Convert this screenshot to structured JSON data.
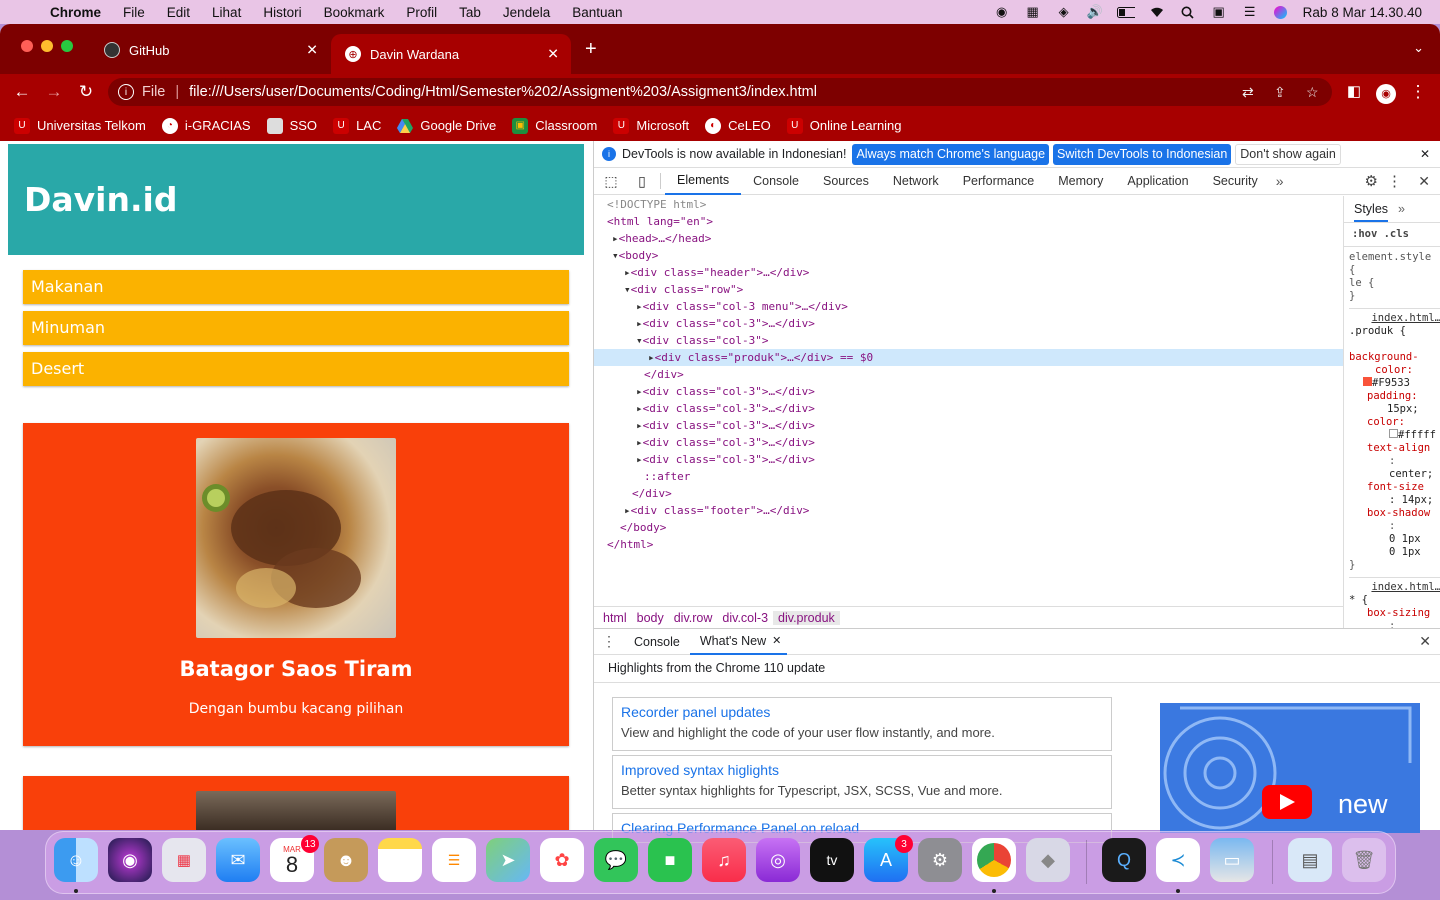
{
  "menubar": {
    "app": "Chrome",
    "items": [
      "File",
      "Edit",
      "Lihat",
      "Histori",
      "Bookmark",
      "Profil",
      "Tab",
      "Jendela",
      "Bantuan"
    ],
    "clock": "Rab 8 Mar  14.30.40"
  },
  "tabs": [
    {
      "title": "GitHub",
      "active": false
    },
    {
      "title": "Davin Wardana",
      "active": true
    }
  ],
  "toolbar": {
    "scheme_label": "File",
    "url": "file:///Users/user/Documents/Coding/Html/Semester%202/Assigment%203/Assigment3/index.html"
  },
  "bookmarks": [
    "Universitas Telkom",
    "i-GRACIAS",
    "SSO",
    "LAC",
    "Google Drive",
    "Classroom",
    "Microsoft",
    "CeLEO",
    "Online Learning"
  ],
  "page": {
    "site_title": "Davin.id",
    "menu": [
      "Makanan",
      "Minuman",
      "Desert"
    ],
    "products": [
      {
        "name": "Batagor Saos Tiram",
        "desc": "Dengan bumbu kacang pilihan"
      }
    ]
  },
  "devtools": {
    "info_text": "DevTools is now available in Indonesian!",
    "btn_match": "Always match Chrome's language",
    "btn_switch": "Switch DevTools to Indonesian",
    "btn_dismiss": "Don't show again",
    "tabs": [
      "Elements",
      "Console",
      "Sources",
      "Network",
      "Performance",
      "Memory",
      "Application",
      "Security"
    ],
    "dom": [
      "<!DOCTYPE html>",
      "<html lang=\"en\">",
      "<head>…</head>",
      "<body>",
      "<div class=\"header\">…</div>",
      "<div class=\"row\">",
      "<div class=\"col-3 menu\">…</div>",
      "<div class=\"col-3\">…</div>",
      "<div class=\"col-3\">",
      "<div class=\"produk\">…</div> == $0",
      "</div>",
      "<div class=\"col-3\">…</div>",
      "<div class=\"col-3\">…</div>",
      "<div class=\"col-3\">…</div>",
      "<div class=\"col-3\">…</div>",
      "<div class=\"col-3\">…</div>",
      "::after",
      "</div>",
      "<div class=\"footer\">…</div>",
      "</body>",
      "</html>"
    ],
    "breadcrumb": [
      "html",
      "body",
      "div.row",
      "div.col-3",
      "div.produk"
    ],
    "styles": {
      "tab": "Styles",
      "filter": ":hov  .cls",
      "element_style": "element.style {",
      "element_style_wrap": "le {",
      "source": "index.html…",
      "selector": ".produk {",
      "bg_prop": "background-",
      "bg_prop2": "color:",
      "bg_val": "#F9533",
      "padding": "padding:",
      "padding_val": "15px;",
      "color": "color:",
      "color_val": "#fffff",
      "text_align": "text-align",
      "text_align_val": "center;",
      "font_size": "font-size",
      "font_size_val": ": 14px;",
      "box_shadow": "box-shadow",
      "shadow_val": "0 1px ",
      "universal": "* {",
      "box_sizing": "box-sizing"
    },
    "drawer": {
      "tab_console": "Console",
      "tab_whatsnew": "What's New",
      "highlights": "Highlights from the Chrome 110 update",
      "cards": [
        {
          "title": "Recorder panel updates",
          "desc": "View and highlight the code of your user flow instantly, and more."
        },
        {
          "title": "Improved syntax higlights",
          "desc": "Better syntax highlights for Typescript, JSX, SCSS, Vue and more."
        },
        {
          "title": "Clearing Performance Panel on reload",
          "desc": ""
        }
      ],
      "video_label": "new"
    }
  },
  "dock": {
    "calendar_month": "MAR",
    "calendar_day": "8",
    "calendar_badge": "13",
    "appstore_badge": "3"
  },
  "colors": {
    "tab_strip": "#7d0000",
    "toolbar": "#a70000",
    "site_header": "#29a8a8",
    "menu_item": "#fbb200",
    "produk": "#f9400a"
  }
}
